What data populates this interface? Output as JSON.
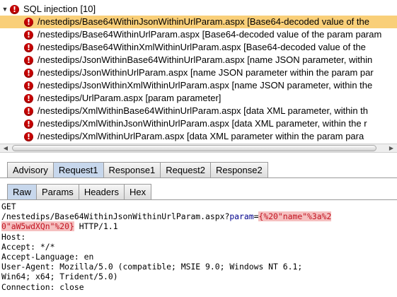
{
  "tree": {
    "group_label": "SQL injection [10]",
    "rows": [
      {
        "label": "/nestedips/Base64WithinJsonWithinUrlParam.aspx [Base64-decoded value of the",
        "selected": true
      },
      {
        "label": "/nestedips/Base64WithinUrlParam.aspx [Base64-decoded value of the param param"
      },
      {
        "label": "/nestedips/Base64WithinXmlWithinUrlParam.aspx [Base64-decoded value of the"
      },
      {
        "label": "/nestedips/JsonWithinBase64WithinUrlParam.aspx [name JSON parameter, within"
      },
      {
        "label": "/nestedips/JsonWithinUrlParam.aspx [name JSON parameter within the param par"
      },
      {
        "label": "/nestedips/JsonWithinXmlWithinUrlParam.aspx [name JSON parameter, within the"
      },
      {
        "label": "/nestedips/UrlParam.aspx [param parameter]"
      },
      {
        "label": "/nestedips/XmlWithinBase64WithinUrlParam.aspx [data XML parameter, within th"
      },
      {
        "label": "/nestedips/XmlWithinJsonWithinUrlParam.aspx [data XML parameter, within the r"
      },
      {
        "label": "/nestedips/XmlWithinUrlParam.aspx [data XML parameter within the param para"
      }
    ]
  },
  "icons": {
    "expander": "chevron-down-icon",
    "severity": "exclamation-icon",
    "severity_color": "#c60000"
  },
  "tabs": {
    "outer": [
      "Advisory",
      "Request1",
      "Response1",
      "Request2",
      "Response2"
    ],
    "outer_active": "Request1",
    "inner": [
      "Raw",
      "Params",
      "Headers",
      "Hex"
    ],
    "inner_active": "Raw"
  },
  "request": {
    "method": "GET",
    "path_prefix": "/nestedips/Base64WithinJsonWithinUrlParam.aspx?",
    "param_name": "param",
    "equals": "=",
    "payload_line1": "{%20\"name\"%3a%2",
    "payload_line2": "0\"aW5wdXQn\"%20}",
    "protocol": " HTTP/1.1",
    "headers": [
      "Host:",
      "Accept: */*",
      "Accept-Language: en",
      "User-Agent: Mozilla/5.0 (compatible; MSIE 9.0; Windows NT 6.1;",
      "Win64; x64; Trident/5.0)",
      "Connection: close"
    ]
  },
  "colors": {
    "selected_row": "#f9cf79",
    "active_tab": "#c7d7ec",
    "highlight_bg": "#f5c0c0",
    "highlight_text": "#c1121f"
  }
}
